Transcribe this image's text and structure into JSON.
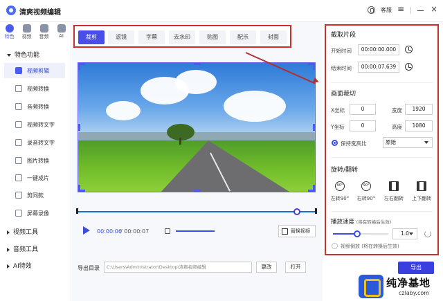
{
  "app": {
    "title": "清爽视频编辑",
    "service_label": "客服"
  },
  "top_icons": [
    {
      "label": "特色",
      "icon": "feature-icon"
    },
    {
      "label": "视频",
      "icon": "video-icon"
    },
    {
      "label": "音频",
      "icon": "audio-icon"
    },
    {
      "label": "AI",
      "icon": "ai-icon"
    }
  ],
  "sidebar": {
    "section_feature": "特色功能",
    "items": [
      {
        "label": "视频剪辑",
        "icon": "video-edit-icon"
      },
      {
        "label": "视频转换",
        "icon": "video-convert-icon"
      },
      {
        "label": "音频转换",
        "icon": "microphone-icon"
      },
      {
        "label": "视频转文字",
        "icon": "video-to-text-icon"
      },
      {
        "label": "录音转文字",
        "icon": "record-to-text-icon"
      },
      {
        "label": "图片转换",
        "icon": "image-convert-icon"
      },
      {
        "label": "一键成片",
        "icon": "one-click-icon"
      },
      {
        "label": "剪同款",
        "icon": "template-icon"
      },
      {
        "label": "屏幕录像",
        "icon": "screen-record-icon"
      }
    ],
    "section_video_tools": "视频工具",
    "section_audio_tools": "音频工具",
    "section_ai": "AI特效"
  },
  "tabs": [
    "裁剪",
    "滤镜",
    "字幕",
    "去水印",
    "贴图",
    "配乐",
    "封面"
  ],
  "player": {
    "current_time": "00:00:06",
    "total_time": "/ 00:00:07",
    "replace_label": "替换视频"
  },
  "export": {
    "label": "导出目录",
    "path": "C:\\Users\\Administrator\\Desktop\\清爽视频编辑",
    "change_label": "更改",
    "open_label": "打开",
    "export_label": "导出"
  },
  "clip": {
    "title": "截取片段",
    "start_label": "开始时间",
    "start_value": "00:00:00.000",
    "end_label": "结束时间",
    "end_value": "00:00:07.639"
  },
  "crop": {
    "title": "画面裁切",
    "x_label": "X坐标",
    "x_value": "0",
    "w_label": "宽度",
    "w_value": "1920",
    "y_label": "Y坐标",
    "y_value": "0",
    "h_label": "高度",
    "h_value": "1080",
    "keep_ratio_label": "保持宽高比",
    "ratio_value": "原始"
  },
  "rotate": {
    "title": "旋转/翻转",
    "left_label": "左转90°",
    "left_icon_text": "90°",
    "right_label": "右转90°",
    "right_icon_text": "90°",
    "flip_h_label": "左右翻转",
    "flip_v_label": "上下翻转"
  },
  "speed": {
    "title": "播放速度",
    "note": "(将在转换后生效)",
    "value": "1.0",
    "reverse_label": "视频倒放",
    "reverse_note": "(将在转换后生效)"
  },
  "watermark": {
    "text": "纯净基地",
    "url": "czlaby.com"
  }
}
